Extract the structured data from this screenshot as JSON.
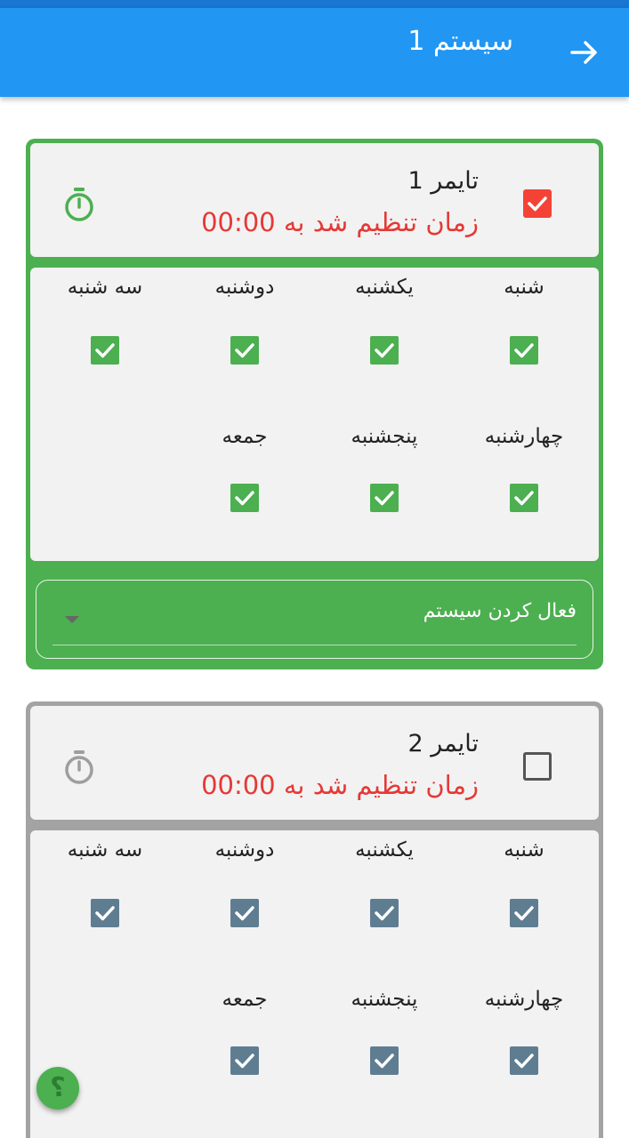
{
  "app_bar": {
    "title": "سیستم 1"
  },
  "timers": [
    {
      "name": "تایمر 1",
      "time_text": "زمان تنظیم شد به 00:00",
      "enabled": true,
      "days": [
        "شنبه",
        "یکشنبه",
        "دوشنبه",
        "سه شنبه",
        "چهارشنبه",
        "پنجشنبه",
        "جمعه"
      ],
      "system_select": {
        "value": "فعال کردن سیستم"
      }
    },
    {
      "name": "تایمر 2",
      "time_text": "زمان تنظیم شد به 00:00",
      "enabled": false,
      "days": [
        "شنبه",
        "یکشنبه",
        "دوشنبه",
        "سه شنبه",
        "چهارشنبه",
        "پنجشنبه",
        "جمعه"
      ]
    }
  ],
  "colors": {
    "app_bar": "#2196f3",
    "active_card": "#4caf50",
    "inactive_card": "#a3a3a3",
    "time_text": "#e53935",
    "enable_checkbox": "#f44336",
    "day_checkbox_active": "#4caf50",
    "day_checkbox_inactive": "#5f7d91"
  },
  "icons": {
    "back": "arrow-right-icon",
    "timer": "stopwatch-icon",
    "check": "check-icon",
    "dropdown": "caret-down-icon",
    "help": "question-icon"
  },
  "help_fab": {
    "glyph": "؟"
  }
}
